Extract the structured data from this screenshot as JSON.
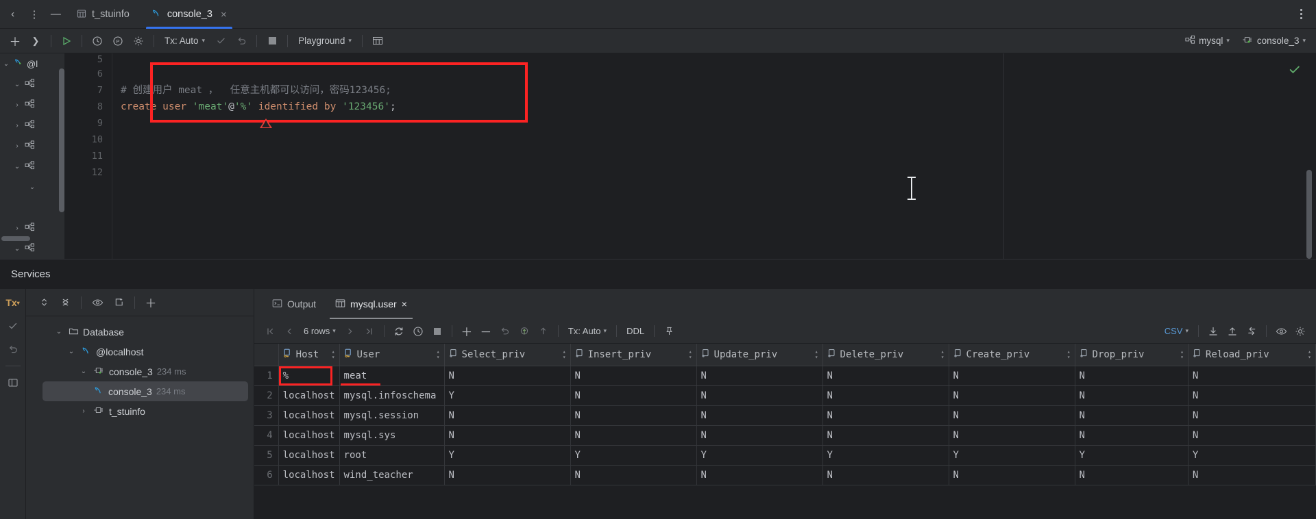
{
  "window": {
    "menu_icon": "kebab-menu",
    "minimize_icon": "minimize",
    "overflow_icon": "more-vertical"
  },
  "tabs": [
    {
      "label": "t_stuinfo",
      "icon": "table-icon",
      "active": false,
      "closable": false
    },
    {
      "label": "console_3",
      "icon": "dolphin-icon",
      "active": true,
      "closable": true
    }
  ],
  "toolbar": {
    "run_icon": "run-play-icon",
    "history_icon": "clock-history-icon",
    "profile_icon": "p-circle-icon",
    "settings_icon": "gear-icon",
    "tx_label": "Tx: Auto",
    "commit_icon": "check-commit-icon",
    "rollback_icon": "rollback-icon",
    "stop_icon": "stop-square-icon",
    "schema_label": "Playground",
    "table_icon": "table-grid-icon",
    "datasource_label": "mysql",
    "datasource_icon": "schema-icon",
    "session_label": "console_3",
    "session_icon": "connection-icon"
  },
  "editor": {
    "first_line_number": 5,
    "lines": [
      {
        "n": 5,
        "text": ""
      },
      {
        "n": 6,
        "text": ""
      },
      {
        "n": 7,
        "text": "# 创建用户 meat ，  任意主机都可以访问，密码123456;"
      },
      {
        "n": 8,
        "text": "create user 'meat'@'%' identified by '123456';"
      },
      {
        "n": 9,
        "text": ""
      },
      {
        "n": 10,
        "text": ""
      },
      {
        "n": 11,
        "text": ""
      },
      {
        "n": 12,
        "text": ""
      }
    ],
    "code_line_7_comment": "# 创建用户 meat ，  任意主机都可以访问，密码123456;",
    "code_line_8": {
      "kw_create": "create",
      "kw_user": "user",
      "str_user": "'meat'",
      "at": "@",
      "str_host": "'%'",
      "kw_identified": "identified",
      "kw_by": "by",
      "str_pwd": "'123456'",
      "semi": ";"
    },
    "status_ok_icon": "green-check-icon",
    "highlight_color": "#fb2323",
    "warning_icon": "warning-triangle-icon"
  },
  "services": {
    "title": "Services",
    "rail": [
      "Tx",
      "commit-check-icon",
      "rollback-icon",
      "layout-icon"
    ],
    "tree_toolbar": [
      "expand-collapse-icon",
      "collapse-all-icon",
      "eye-icon",
      "new-window-icon",
      "add-icon"
    ],
    "tree": [
      {
        "label": "Database",
        "icon": "folder-icon",
        "indent": 0,
        "expanded": true,
        "time": ""
      },
      {
        "label": "@localhost",
        "icon": "dolphin-icon",
        "indent": 1,
        "expanded": true,
        "time": ""
      },
      {
        "label": "console_3",
        "icon": "connection-icon",
        "indent": 2,
        "expanded": true,
        "time": "234 ms"
      },
      {
        "label": "console_3",
        "icon": "dolphin-icon",
        "indent": 3,
        "expanded": null,
        "time": "234 ms",
        "selected": true
      },
      {
        "label": "t_stuinfo",
        "icon": "connection-icon",
        "indent": 2,
        "expanded": false,
        "time": ""
      }
    ]
  },
  "results": {
    "tabs": [
      {
        "label": "Output",
        "icon": "console-output-icon",
        "active": false,
        "closable": false
      },
      {
        "label": "mysql.user",
        "icon": "table-icon",
        "active": true,
        "closable": true
      }
    ],
    "toolbar": {
      "first_icon": "first-page-icon",
      "prev_icon": "prev-page-icon",
      "rows_label": "6 rows",
      "next_icon": "next-page-icon",
      "last_icon": "last-page-icon",
      "refresh_icon": "refresh-icon",
      "history_icon": "clock-history-icon",
      "stop_icon": "stop-square-icon",
      "add_row_icon": "plus-icon",
      "del_row_icon": "minus-icon",
      "revert_icon": "revert-icon",
      "submit_icon": "submit-icon",
      "upload_icon": "upload-arrow-icon",
      "tx_label": "Tx: Auto",
      "ddl_label": "DDL",
      "pin_icon": "pin-icon",
      "format_label": "CSV",
      "download_icon": "download-icon",
      "import_icon": "import-icon",
      "export_icon": "export-icon",
      "view_icon": "eye-icon",
      "settings_icon": "gear-icon"
    },
    "columns": [
      {
        "name": "Host",
        "key": true
      },
      {
        "name": "User",
        "key": true
      },
      {
        "name": "Select_priv",
        "key": false
      },
      {
        "name": "Insert_priv",
        "key": false
      },
      {
        "name": "Update_priv",
        "key": false
      },
      {
        "name": "Delete_priv",
        "key": false
      },
      {
        "name": "Create_priv",
        "key": false
      },
      {
        "name": "Drop_priv",
        "key": false
      },
      {
        "name": "Reload_priv",
        "key": false
      }
    ],
    "rows": [
      {
        "n": "1",
        "cells": [
          "%",
          "meat",
          "N",
          "N",
          "N",
          "N",
          "N",
          "N",
          "N"
        ],
        "highlight_host": true
      },
      {
        "n": "2",
        "cells": [
          "localhost",
          "mysql.infoschema",
          "Y",
          "N",
          "N",
          "N",
          "N",
          "N",
          "N"
        ]
      },
      {
        "n": "3",
        "cells": [
          "localhost",
          "mysql.session",
          "N",
          "N",
          "N",
          "N",
          "N",
          "N",
          "N"
        ]
      },
      {
        "n": "4",
        "cells": [
          "localhost",
          "mysql.sys",
          "N",
          "N",
          "N",
          "N",
          "N",
          "N",
          "N"
        ]
      },
      {
        "n": "5",
        "cells": [
          "localhost",
          "root",
          "Y",
          "Y",
          "Y",
          "Y",
          "Y",
          "Y",
          "Y"
        ]
      },
      {
        "n": "6",
        "cells": [
          "localhost",
          "wind_teacher",
          "N",
          "N",
          "N",
          "N",
          "N",
          "N",
          "N"
        ]
      }
    ]
  },
  "colors": {
    "accent": "#3574f0",
    "annotation_red": "#fb2323",
    "ok_green": "#5fa86a",
    "keyword_orange": "#cf8e6d",
    "string_green": "#6aab73",
    "comment_gray": "#7a7e85"
  }
}
